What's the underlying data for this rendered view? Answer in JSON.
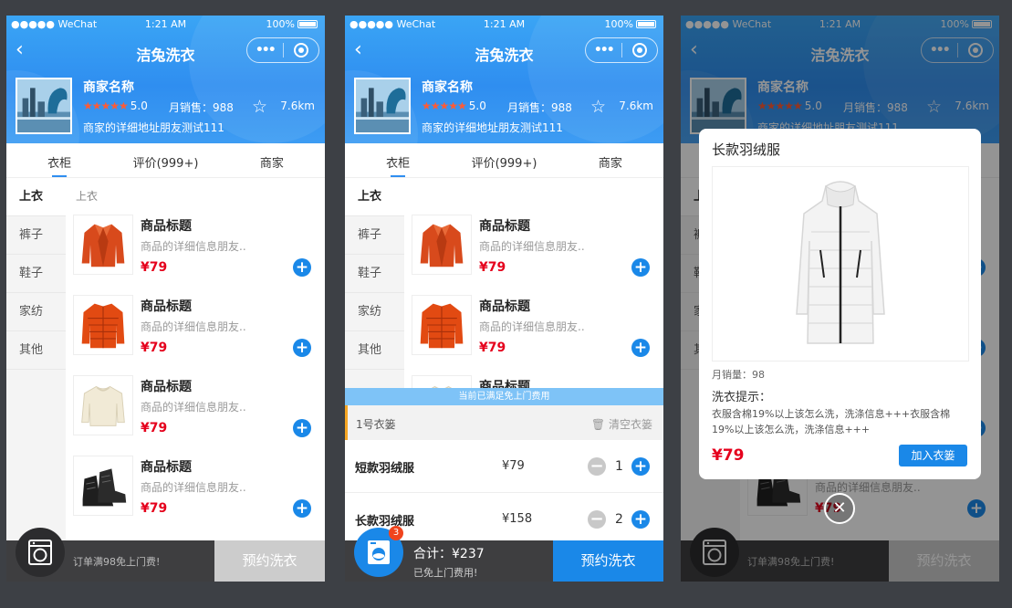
{
  "status": {
    "carrier": "●●●●● WeChat",
    "time": "1:21 AM",
    "battery": "100%"
  },
  "nav": {
    "title": "洁兔洗衣",
    "back": "‹",
    "more": "•••"
  },
  "merchant": {
    "name": "商家名称",
    "stars": "★★★★★",
    "score": "5.0",
    "sales": "月销售：988",
    "distance": "7.6km",
    "address": "商家的详细地址朋友测试111"
  },
  "tabs": [
    "衣柜",
    "评价(999+)",
    "商家"
  ],
  "categories": [
    "上衣",
    "裤子",
    "鞋子",
    "家纺",
    "其他"
  ],
  "section_title": "上衣",
  "products": [
    {
      "title": "商品标题",
      "desc": "商品的详细信息朋友..",
      "price": "¥79"
    },
    {
      "title": "商品标题",
      "desc": "商品的详细信息朋友..",
      "price": "¥79"
    },
    {
      "title": "商品标题",
      "desc": "商品的详细信息朋友..",
      "price": "¥79"
    },
    {
      "title": "商品标题",
      "desc": "商品的详细信息朋友..",
      "price": "¥79"
    }
  ],
  "bottom": {
    "hint": "订单满98免上门费!",
    "book": "预约洗衣",
    "total": "合计：¥237",
    "free": "已免上门费用!",
    "badge": "3"
  },
  "cart": {
    "tip": "当前已满足免上门费用",
    "basket": "1号衣篓",
    "clear": "清空衣篓",
    "items": [
      {
        "name": "短款羽绒服",
        "price": "¥79",
        "qty": "1"
      },
      {
        "name": "长款羽绒服",
        "price": "¥158",
        "qty": "2"
      }
    ]
  },
  "modal": {
    "title": "长款羽绒服",
    "monthly": "月销量：98",
    "wash_label": "洗衣提示：",
    "wash_text": "衣服含棉19%以上该怎么洗，洗涤信息+++衣服含棉19%以上该怎么洗，洗涤信息+++",
    "price": "¥79",
    "add": "加入衣篓",
    "close": "✕"
  },
  "colors": {
    "accent": "#1a88e8",
    "price": "#e5001c",
    "header": "#2f8ef0",
    "star": "#ff5b35"
  },
  "icons": {
    "back": "chevron-left-icon",
    "more": "more-icon",
    "target": "target-icon",
    "favorite": "star-outline-icon",
    "washer": "washing-machine-icon",
    "trash": "trash-icon"
  }
}
